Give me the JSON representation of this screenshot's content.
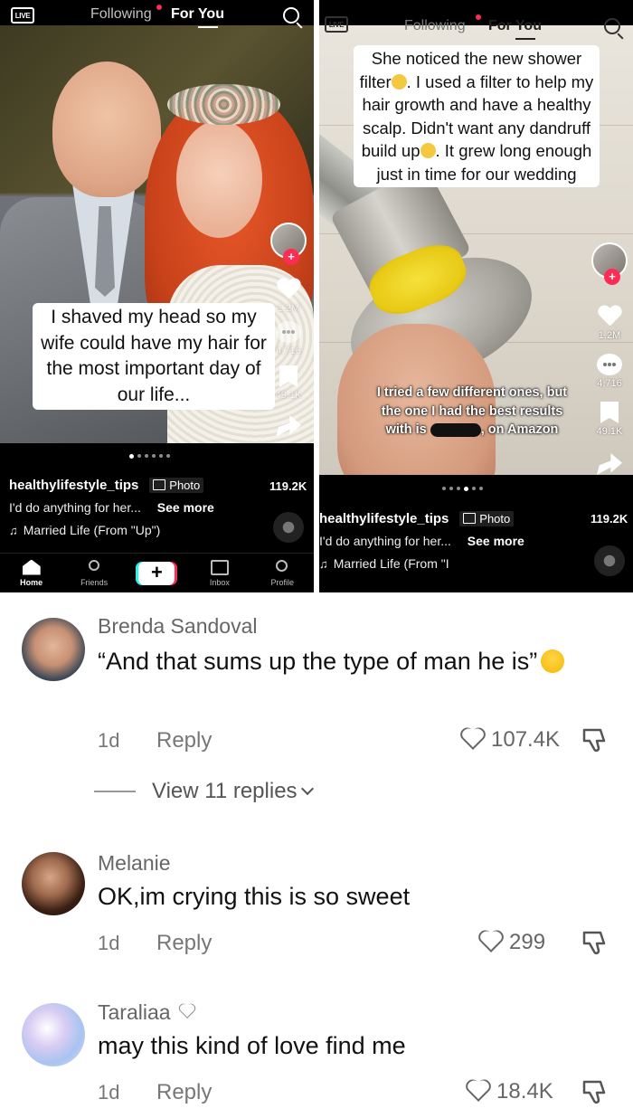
{
  "left_post": {
    "nav": {
      "live": "LIVE",
      "following": "Following",
      "for_you": "For You"
    },
    "caption": "I shaved my head so my wife could have my hair for the most important day of our life...",
    "rail": {
      "likes": "1.2M",
      "comments": "4,716",
      "saves": "49.1K",
      "shares": "119.2K"
    },
    "username": "healthylifestyle_tips",
    "badge": "Photo",
    "description": "I'd do anything for her...",
    "see_more": "See more",
    "music": "Married Life (From \"Up\")",
    "bottom_nav": {
      "home": "Home",
      "friends": "Friends",
      "inbox": "Inbox",
      "profile": "Profile",
      "create": "+"
    }
  },
  "right_post": {
    "nav": {
      "live": "LIVE",
      "following": "Following",
      "for_you": "For You"
    },
    "caption": "She noticed the new shower filter. I used a filter to help my hair growth and have a healthy scalp. Didn't want any dandruff build up. It grew long enough just in time for our wedding",
    "caption_parts": {
      "p1": "She noticed the new shower filter",
      "p2": ". I used a filter to help  my hair growth and have a healthy scalp. Didn't want any dandruff build up",
      "p3": ". It grew long enough just in time for our wedding"
    },
    "overlay_parts": {
      "before": "I tried a few different ones, but the one I had the best results with is",
      "after": ", on Amazon"
    },
    "rail": {
      "likes": "1.2M",
      "comments": "4,716",
      "saves": "49.1K",
      "shares": "119.2K"
    },
    "username": "healthylifestyle_tips",
    "badge": "Photo",
    "description": "I'd do anything for her...",
    "see_more": "See more",
    "music": "Married Life (From \"I"
  },
  "comments": [
    {
      "name": "Brenda Sandoval",
      "text": "“And that sums up the type of man he is”",
      "age": "1d",
      "reply": "Reply",
      "likes": "107.4K",
      "view_replies": "View 11 replies"
    },
    {
      "name": "Melanie",
      "text": "OK,im crying this is so sweet",
      "age": "1d",
      "reply": "Reply",
      "likes": "299"
    },
    {
      "name": "Taraliaa",
      "text": "may this kind of love find me",
      "age": "1d",
      "reply": "Reply",
      "likes": "18.4K"
    }
  ],
  "colors": {
    "accent": "#fe2c55",
    "teal": "#25f4ee",
    "background_dark": "#000000"
  }
}
